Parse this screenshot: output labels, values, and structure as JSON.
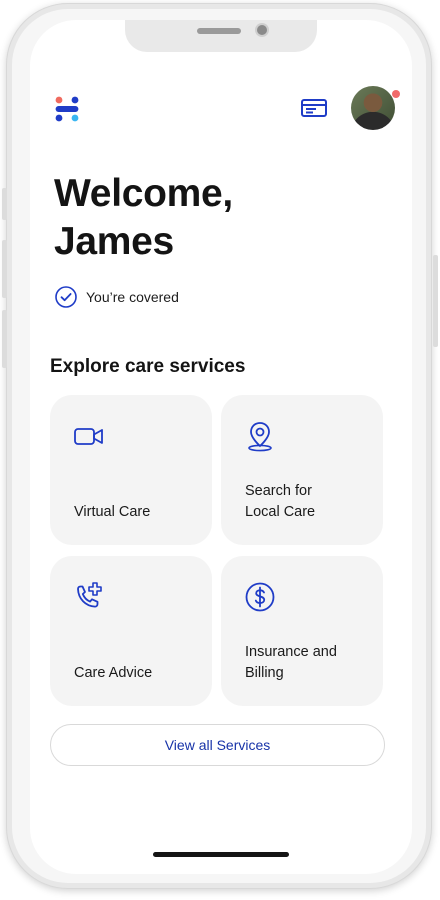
{
  "header": {
    "logo_icon": "app-logo-icon",
    "card_icon": "insurance-card-icon",
    "avatar_icon": "user-avatar",
    "notification_dot_color": "#f06a6a"
  },
  "welcome": {
    "line1": "Welcome,",
    "line2": "James"
  },
  "coverage": {
    "icon": "check-circle-icon",
    "text": "You’re covered"
  },
  "section": {
    "title": "Explore care services"
  },
  "services": [
    {
      "icon": "video-camera-icon",
      "label": "Virtual Care"
    },
    {
      "icon": "map-pin-icon",
      "label_line1": "Search for",
      "label_line2": "Local Care"
    },
    {
      "icon": "phone-plus-icon",
      "label": "Care Advice"
    },
    {
      "icon": "dollar-circle-icon",
      "label_line1": "Insurance and",
      "label_line2": "Billing"
    }
  ],
  "actions": {
    "view_all_label": "View all Services"
  },
  "colors": {
    "accent": "#1733a8",
    "tile_bg": "#f4f4f4",
    "text": "#141414"
  }
}
